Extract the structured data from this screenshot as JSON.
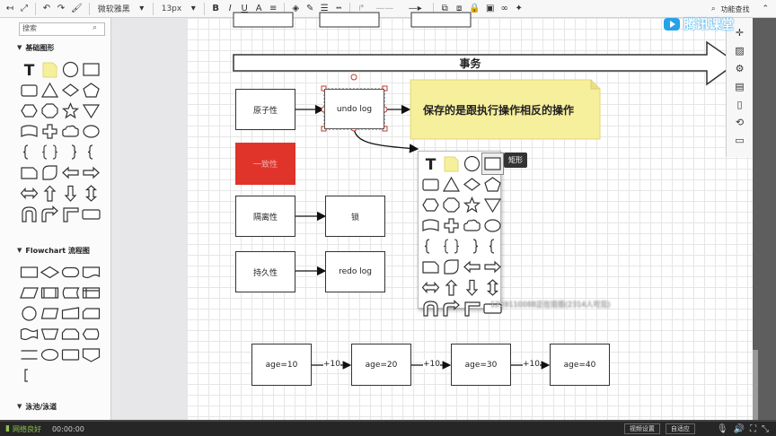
{
  "toolbar": {
    "font_family": "微软雅黑",
    "font_size": "13px",
    "bold": "B",
    "italic": "I",
    "underline": "U",
    "right_feature": "功能查找"
  },
  "brand": {
    "name": "腾讯课堂",
    "color": "#26a2e8"
  },
  "left_panel": {
    "search_placeholder": "搜索",
    "sections": [
      {
        "label": "基础图形"
      },
      {
        "label": "Flowchart 流程图"
      },
      {
        "label": "泳池/泳道"
      }
    ]
  },
  "diagram": {
    "banner": "事务",
    "note": "保存的是跟执行操作相反的操作",
    "note_color": "#f6ef9c",
    "boxes": {
      "atomicity": "原子性",
      "undo_log": "undo log",
      "consistency": "一致性",
      "isolation": "隔离性",
      "lock": "锁",
      "durability": "持久性",
      "redo_log": "redo log"
    },
    "consistency_color": "#e0342b",
    "age_boxes": [
      "age=10",
      "age=20",
      "age=30",
      "age=40"
    ],
    "increments": [
      "+10",
      "+10",
      "+10"
    ]
  },
  "popup": {
    "tooltip": "矩形"
  },
  "overlay_text": "1259110088正在观看(2314人可见)",
  "bottom_bar": {
    "network": "网络良好",
    "time": "00:00:00",
    "progress_fraction": 0.0,
    "video_settings": "视频设置",
    "adaptive": "自适应"
  }
}
